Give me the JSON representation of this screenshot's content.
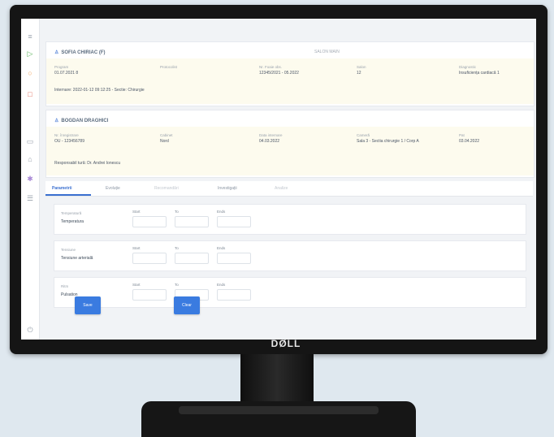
{
  "monitor": {
    "brand": "DØLL"
  },
  "sidebar": {
    "icons": [
      "menu-icon",
      "play-icon",
      "user-icon",
      "document-icon",
      "folder-icon",
      "lock-icon",
      "settings-icon",
      "list-icon",
      "logout-icon"
    ]
  },
  "patient_card": {
    "title": "SOFIA CHIRIAC (F)",
    "center_tag": "SALON MAIN",
    "fields": [
      {
        "label": "Program",
        "value": "01.07.2021 8"
      },
      {
        "label": "Protocolist",
        "value": ""
      },
      {
        "label": "Nr. Foaie obs.",
        "value": "12345/2021 - 05.2022"
      },
      {
        "label": "Salon",
        "value": "12"
      },
      {
        "label": "Diagnostic",
        "value": "Insuficiența cardiacă 1"
      }
    ],
    "note": "Internare: 2022-01-12 09:12:25 - Sectie: Chirurgie"
  },
  "doctor_card": {
    "title": "BOGDAN DRAGHICI",
    "fields": [
      {
        "label": "Nr. înregistrare",
        "value": "OU - 123456789"
      },
      {
        "label": "Cabinet",
        "value": "Nord"
      },
      {
        "label": "Data internare",
        "value": "04.03.2022"
      },
      {
        "label": "Cameră",
        "value": "Sala 3 - Sectia chirurgie 1 / Corp A"
      },
      {
        "label": "Pat",
        "value": "03.04.2022"
      }
    ],
    "note": "Responsabil tură: Dr. Andrei Ionescu"
  },
  "tabs": [
    {
      "label": "Parametrii",
      "state": "active"
    },
    {
      "label": "Evoluție",
      "state": "normal"
    },
    {
      "label": "Recomandări",
      "state": "muted"
    },
    {
      "label": "Investigații",
      "state": "normal"
    },
    {
      "label": "Analize",
      "state": "muted"
    }
  ],
  "measurements": [
    {
      "small": "Temperatură",
      "name": "Temperatura",
      "cols": [
        "Start",
        "To",
        "Ends"
      ]
    },
    {
      "small": "Tensiune",
      "name": "Tensiune arterială",
      "cols": [
        "Start",
        "To",
        "Ends"
      ]
    },
    {
      "small": "Ritm",
      "name": "Pulsation",
      "cols": [
        "Start",
        "To",
        "Ends"
      ]
    }
  ],
  "buttons": {
    "save": "Save",
    "clear": "Clear"
  }
}
